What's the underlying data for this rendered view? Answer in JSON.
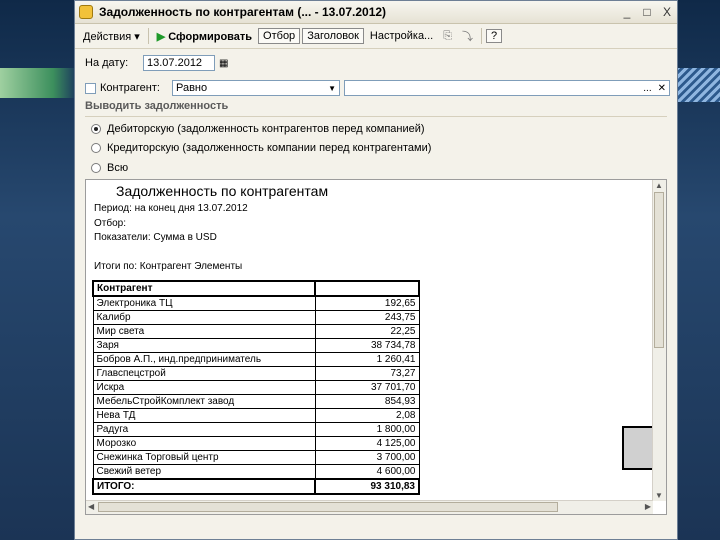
{
  "window": {
    "title": "Задолженность по контрагентам (... - 13.07.2012)",
    "controls": {
      "minimize": "_",
      "maximize": "□",
      "close": "X"
    }
  },
  "toolbar": {
    "actions": "Действия ▾",
    "generate": "Сформировать",
    "filter": "Отбор",
    "header": "Заголовок",
    "settings": "Настройка...",
    "help": "?"
  },
  "form": {
    "date_label": "На дату:",
    "date_value": "13.07.2012",
    "counterparty_label": "Контрагент:",
    "counterparty_condition": "Равно",
    "counterparty_value": "",
    "section_title": "Выводить задолженность",
    "options": [
      {
        "label": "Дебиторскую (задолженность контрагентов перед компанией)",
        "selected": true
      },
      {
        "label": "Кредиторскую (задолженность компании перед контрагентами)",
        "selected": false
      },
      {
        "label": "Всю",
        "selected": false
      }
    ]
  },
  "report": {
    "title": "Задолженность по контрагентам",
    "period": "Период: на конец дня 13.07.2012",
    "filter": "Отбор:",
    "indicators": "Показатели: Сумма в USD",
    "totals_by": "Итоги по: Контрагент Элементы",
    "column_header": "Контрагент",
    "rows": [
      {
        "name": "Электроника ТЦ",
        "value": "192,65"
      },
      {
        "name": "Калибр",
        "value": "243,75"
      },
      {
        "name": "Мир света",
        "value": "22,25"
      },
      {
        "name": "Заря",
        "value": "38 734,78"
      },
      {
        "name": "Бобров А.П., инд.предприниматель",
        "value": "1 260,41"
      },
      {
        "name": "Главспецстрой",
        "value": "73,27"
      },
      {
        "name": "Искра",
        "value": "37 701,70"
      },
      {
        "name": "МебельСтройКомплект завод",
        "value": "854,93"
      },
      {
        "name": "Нева ТД",
        "value": "2,08"
      },
      {
        "name": "Радуга",
        "value": "1 800,00"
      },
      {
        "name": "Морозко",
        "value": "4 125,00"
      },
      {
        "name": "Снежинка Торговый центр",
        "value": "3 700,00"
      },
      {
        "name": "Свежий ветер",
        "value": "4 600,00"
      }
    ],
    "total_label": "ИТОГО:",
    "total_value": "93 310,83"
  }
}
